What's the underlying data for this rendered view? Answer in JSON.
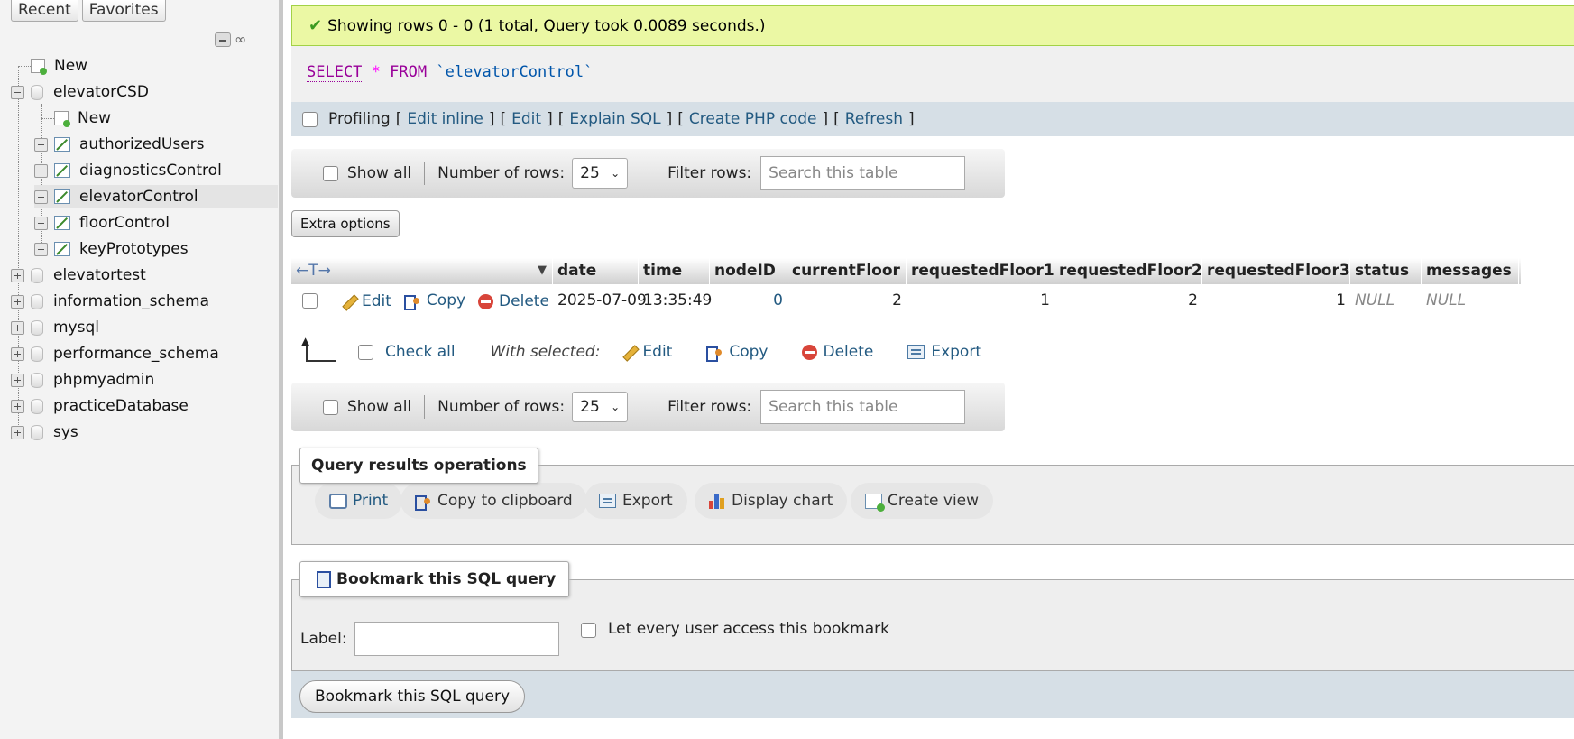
{
  "sidebar": {
    "tabs": [
      "Recent",
      "Favorites"
    ],
    "tools": {
      "collapse_icon": "collapse-all-icon",
      "link_icon": "link-icon",
      "link_glyph": "∞"
    },
    "tree": [
      {
        "label": "New",
        "type": "new",
        "level": 0
      },
      {
        "label": "elevatorCSD",
        "type": "db",
        "level": 0,
        "expanded": true
      },
      {
        "label": "New",
        "type": "new",
        "level": 1
      },
      {
        "label": "authorizedUsers",
        "type": "table",
        "level": 1
      },
      {
        "label": "diagnosticsControl",
        "type": "table",
        "level": 1
      },
      {
        "label": "elevatorControl",
        "type": "table",
        "level": 1,
        "selected": true
      },
      {
        "label": "floorControl",
        "type": "table",
        "level": 1
      },
      {
        "label": "keyPrototypes",
        "type": "table",
        "level": 1
      },
      {
        "label": "elevatortest",
        "type": "db",
        "level": 0
      },
      {
        "label": "information_schema",
        "type": "db",
        "level": 0
      },
      {
        "label": "mysql",
        "type": "db",
        "level": 0
      },
      {
        "label": "performance_schema",
        "type": "db",
        "level": 0
      },
      {
        "label": "phpmyadmin",
        "type": "db",
        "level": 0
      },
      {
        "label": "practiceDatabase",
        "type": "db",
        "level": 0
      },
      {
        "label": "sys",
        "type": "db",
        "level": 0
      }
    ]
  },
  "main": {
    "success": "Showing rows 0 - 0 (1 total, Query took 0.0089 seconds.)",
    "sql": {
      "select": "SELECT",
      "star": "*",
      "from": "FROM",
      "table": "`elevatorControl`"
    },
    "profiling": {
      "label": "Profiling",
      "links": [
        "Edit inline",
        "Edit",
        "Explain SQL",
        "Create PHP code",
        "Refresh"
      ],
      "open_bracket": "[",
      "close_bracket": "]"
    },
    "nav": {
      "show_all": "Show all",
      "rows_label": "Number of rows:",
      "rows_value": "25",
      "filter_label": "Filter rows:",
      "filter_placeholder": "Search this table"
    },
    "extra_options": "Extra options",
    "table": {
      "arrows": "←T→",
      "columns": [
        "date",
        "time",
        "nodeID",
        "currentFloor",
        "requestedFloor1",
        "requestedFloor2",
        "requestedFloor3",
        "status",
        "messages"
      ],
      "row_actions": {
        "edit": "Edit",
        "copy": "Copy",
        "delete": "Delete"
      },
      "rows": [
        {
          "date": "2025-07-09",
          "time": "13:35:49",
          "nodeID": "0",
          "currentFloor": "2",
          "requestedFloor1": "1",
          "requestedFloor2": "2",
          "requestedFloor3": "1",
          "status": "NULL",
          "messages": "NULL"
        }
      ]
    },
    "with_selected": {
      "check_all": "Check all",
      "label": "With selected:",
      "actions": [
        "Edit",
        "Copy",
        "Delete",
        "Export"
      ]
    },
    "query_ops": {
      "legend": "Query results operations",
      "buttons": [
        "Print",
        "Copy to clipboard",
        "Export",
        "Display chart",
        "Create view"
      ]
    },
    "bookmark": {
      "legend": "Bookmark this SQL query",
      "label": "Label:",
      "label_value": "",
      "share": "Let every user access this bookmark",
      "submit": "Bookmark this SQL query"
    }
  },
  "colors": {
    "link": "#235a81",
    "success_bg": "#ebf8a4",
    "keyword": "#990099",
    "profiling_bg": "#d6dfe6"
  }
}
